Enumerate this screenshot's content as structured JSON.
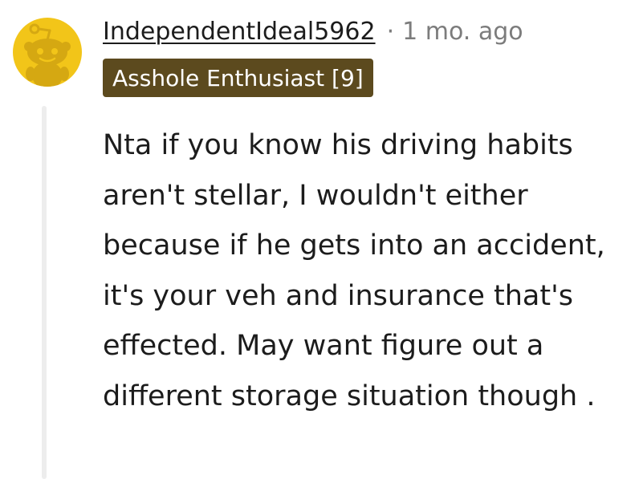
{
  "comment": {
    "username": "IndependentIdeal5962",
    "separator": "·",
    "timestamp": "1 mo. ago",
    "flair": "Asshole Enthusiast [9]",
    "body": "Nta if you know his driving habits aren't stellar, I wouldn't either because if he gets into an accident, it's your veh and insurance that's effected. May want figure out a different storage situation though ."
  },
  "avatar": {
    "icon": "snoo-icon",
    "background_color": "#f2c519",
    "figure_color": "#d5a812"
  },
  "colors": {
    "flair_background": "#5c4a1e",
    "flair_text": "#ffffff",
    "muted_text": "#7c7c7c",
    "thread_line": "#ededed"
  }
}
